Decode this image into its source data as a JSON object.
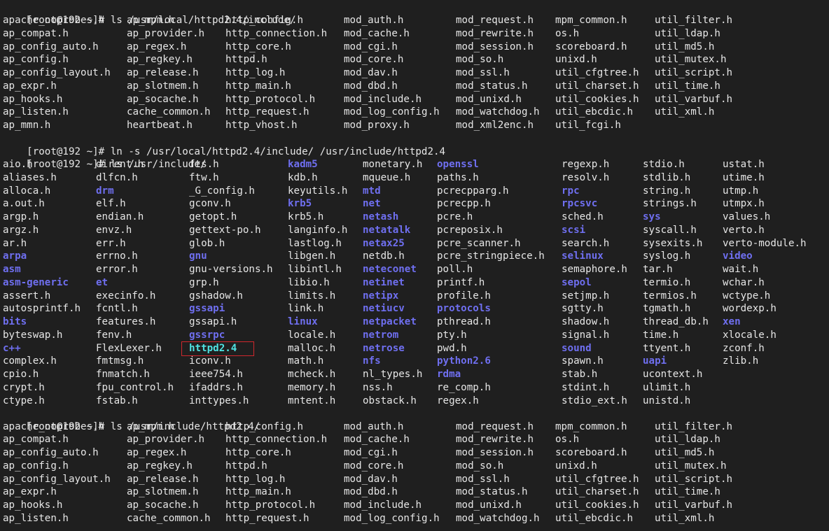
{
  "terminal": {
    "prompt": "[root@192 ~]# ",
    "colors": {
      "background": "#1f1f1f",
      "text": "#e6e6e6",
      "directory": "#6f6ff0",
      "symlink": "#4fe3e3",
      "highlight_box": "#d0282d"
    },
    "commands": [
      "ls /usr/local/httpd2.4/include/",
      "ln -s /usr/local/httpd2.4/include/ /usr/include/httpd2.4",
      "ls /usr/include/",
      "ls /usr/include/httpd2.4/"
    ],
    "listing_httpd_include": {
      "columns": [
        [
          "apache_noprobes.h",
          "ap_compat.h",
          "ap_config_auto.h",
          "ap_config.h",
          "ap_config_layout.h",
          "ap_expr.h",
          "ap_hooks.h",
          "ap_listen.h",
          "ap_mmn.h"
        ],
        [
          "ap_mpm.h",
          "ap_provider.h",
          "ap_regex.h",
          "ap_regkey.h",
          "ap_release.h",
          "ap_slotmem.h",
          "ap_socache.h",
          "cache_common.h",
          "heartbeat.h"
        ],
        [
          "http_config.h",
          "http_connection.h",
          "http_core.h",
          "httpd.h",
          "http_log.h",
          "http_main.h",
          "http_protocol.h",
          "http_request.h",
          "http_vhost.h"
        ],
        [
          "mod_auth.h",
          "mod_cache.h",
          "mod_cgi.h",
          "mod_core.h",
          "mod_dav.h",
          "mod_dbd.h",
          "mod_include.h",
          "mod_log_config.h",
          "mod_proxy.h"
        ],
        [
          "mod_request.h",
          "mod_rewrite.h",
          "mod_session.h",
          "mod_so.h",
          "mod_ssl.h",
          "mod_status.h",
          "mod_unixd.h",
          "mod_watchdog.h",
          "mod_xml2enc.h"
        ],
        [
          "mpm_common.h",
          "os.h",
          "scoreboard.h",
          "unixd.h",
          "util_cfgtree.h",
          "util_charset.h",
          "util_cookies.h",
          "util_ebcdic.h",
          "util_fcgi.h"
        ],
        [
          "util_filter.h",
          "util_ldap.h",
          "util_md5.h",
          "util_mutex.h",
          "util_script.h",
          "util_time.h",
          "util_varbuf.h",
          "util_xml.h",
          ""
        ]
      ]
    },
    "listing_usr_include": {
      "columns": [
        [
          {
            "n": "aio.h"
          },
          {
            "n": "aliases.h"
          },
          {
            "n": "alloca.h"
          },
          {
            "n": "a.out.h"
          },
          {
            "n": "argp.h"
          },
          {
            "n": "argz.h"
          },
          {
            "n": "ar.h"
          },
          {
            "n": "arpa",
            "t": "dir"
          },
          {
            "n": "asm",
            "t": "dir"
          },
          {
            "n": "asm-generic",
            "t": "dir"
          },
          {
            "n": "assert.h"
          },
          {
            "n": "autosprintf.h"
          },
          {
            "n": "bits",
            "t": "dir"
          },
          {
            "n": "byteswap.h"
          },
          {
            "n": "c++",
            "t": "dir"
          },
          {
            "n": "complex.h"
          },
          {
            "n": "cpio.h"
          },
          {
            "n": "crypt.h"
          },
          {
            "n": "ctype.h"
          }
        ],
        [
          {
            "n": "dirent.h"
          },
          {
            "n": "dlfcn.h"
          },
          {
            "n": "drm",
            "t": "dir"
          },
          {
            "n": "elf.h"
          },
          {
            "n": "endian.h"
          },
          {
            "n": "envz.h"
          },
          {
            "n": "err.h"
          },
          {
            "n": "errno.h"
          },
          {
            "n": "error.h"
          },
          {
            "n": "et",
            "t": "dir"
          },
          {
            "n": "execinfo.h"
          },
          {
            "n": "fcntl.h"
          },
          {
            "n": "features.h"
          },
          {
            "n": "fenv.h"
          },
          {
            "n": "FlexLexer.h"
          },
          {
            "n": "fmtmsg.h"
          },
          {
            "n": "fnmatch.h"
          },
          {
            "n": "fpu_control.h"
          },
          {
            "n": "fstab.h"
          }
        ],
        [
          {
            "n": "fts.h"
          },
          {
            "n": "ftw.h"
          },
          {
            "n": "_G_config.h"
          },
          {
            "n": "gconv.h"
          },
          {
            "n": "getopt.h"
          },
          {
            "n": "gettext-po.h"
          },
          {
            "n": "glob.h"
          },
          {
            "n": "gnu",
            "t": "dir"
          },
          {
            "n": "gnu-versions.h"
          },
          {
            "n": "grp.h"
          },
          {
            "n": "gshadow.h"
          },
          {
            "n": "gssapi",
            "t": "dir"
          },
          {
            "n": "gssapi.h"
          },
          {
            "n": "gssrpc",
            "t": "dir"
          },
          {
            "n": "httpd2.4",
            "t": "link",
            "highlighted": true
          },
          {
            "n": "iconv.h"
          },
          {
            "n": "ieee754.h"
          },
          {
            "n": "ifaddrs.h"
          },
          {
            "n": "inttypes.h"
          }
        ],
        [
          {
            "n": "kadm5",
            "t": "dir"
          },
          {
            "n": "kdb.h"
          },
          {
            "n": "keyutils.h"
          },
          {
            "n": "krb5",
            "t": "dir"
          },
          {
            "n": "krb5.h"
          },
          {
            "n": "langinfo.h"
          },
          {
            "n": "lastlog.h"
          },
          {
            "n": "libgen.h"
          },
          {
            "n": "libintl.h"
          },
          {
            "n": "libio.h"
          },
          {
            "n": "limits.h"
          },
          {
            "n": "link.h"
          },
          {
            "n": "linux",
            "t": "dir"
          },
          {
            "n": "locale.h"
          },
          {
            "n": "malloc.h"
          },
          {
            "n": "math.h"
          },
          {
            "n": "mcheck.h"
          },
          {
            "n": "memory.h"
          },
          {
            "n": "mntent.h"
          }
        ],
        [
          {
            "n": "monetary.h"
          },
          {
            "n": "mqueue.h"
          },
          {
            "n": "mtd",
            "t": "dir"
          },
          {
            "n": "net",
            "t": "dir"
          },
          {
            "n": "netash",
            "t": "dir"
          },
          {
            "n": "netatalk",
            "t": "dir"
          },
          {
            "n": "netax25",
            "t": "dir"
          },
          {
            "n": "netdb.h"
          },
          {
            "n": "neteconet",
            "t": "dir"
          },
          {
            "n": "netinet",
            "t": "dir"
          },
          {
            "n": "netipx",
            "t": "dir"
          },
          {
            "n": "netiucv",
            "t": "dir"
          },
          {
            "n": "netpacket",
            "t": "dir"
          },
          {
            "n": "netrom",
            "t": "dir"
          },
          {
            "n": "netrose",
            "t": "dir"
          },
          {
            "n": "nfs",
            "t": "dir"
          },
          {
            "n": "nl_types.h"
          },
          {
            "n": "nss.h"
          },
          {
            "n": "obstack.h"
          }
        ],
        [
          {
            "n": "openssl",
            "t": "dir"
          },
          {
            "n": "paths.h"
          },
          {
            "n": "pcrecpparg.h"
          },
          {
            "n": "pcrecpp.h"
          },
          {
            "n": "pcre.h"
          },
          {
            "n": "pcreposix.h"
          },
          {
            "n": "pcre_scanner.h"
          },
          {
            "n": "pcre_stringpiece.h"
          },
          {
            "n": "poll.h"
          },
          {
            "n": "printf.h"
          },
          {
            "n": "profile.h"
          },
          {
            "n": "protocols",
            "t": "dir"
          },
          {
            "n": "pthread.h"
          },
          {
            "n": "pty.h"
          },
          {
            "n": "pwd.h"
          },
          {
            "n": "python2.6",
            "t": "dir"
          },
          {
            "n": "rdma",
            "t": "dir"
          },
          {
            "n": "re_comp.h"
          },
          {
            "n": "regex.h"
          }
        ],
        [
          {
            "n": "regexp.h"
          },
          {
            "n": "resolv.h"
          },
          {
            "n": "rpc",
            "t": "dir"
          },
          {
            "n": "rpcsvc",
            "t": "dir"
          },
          {
            "n": "sched.h"
          },
          {
            "n": "scsi",
            "t": "dir"
          },
          {
            "n": "search.h"
          },
          {
            "n": "selinux",
            "t": "dir"
          },
          {
            "n": "semaphore.h"
          },
          {
            "n": "sepol",
            "t": "dir"
          },
          {
            "n": "setjmp.h"
          },
          {
            "n": "sgtty.h"
          },
          {
            "n": "shadow.h"
          },
          {
            "n": "signal.h"
          },
          {
            "n": "sound",
            "t": "dir"
          },
          {
            "n": "spawn.h"
          },
          {
            "n": "stab.h"
          },
          {
            "n": "stdint.h"
          },
          {
            "n": "stdio_ext.h"
          }
        ],
        [
          {
            "n": "stdio.h"
          },
          {
            "n": "stdlib.h"
          },
          {
            "n": "string.h"
          },
          {
            "n": "strings.h"
          },
          {
            "n": "sys",
            "t": "dir"
          },
          {
            "n": "syscall.h"
          },
          {
            "n": "sysexits.h"
          },
          {
            "n": "syslog.h"
          },
          {
            "n": "tar.h"
          },
          {
            "n": "termio.h"
          },
          {
            "n": "termios.h"
          },
          {
            "n": "tgmath.h"
          },
          {
            "n": "thread_db.h"
          },
          {
            "n": "time.h"
          },
          {
            "n": "ttyent.h"
          },
          {
            "n": "uapi",
            "t": "dir"
          },
          {
            "n": "ucontext.h"
          },
          {
            "n": "ulimit.h"
          },
          {
            "n": "unistd.h"
          }
        ],
        [
          {
            "n": "ustat.h"
          },
          {
            "n": "utime.h"
          },
          {
            "n": "utmp.h"
          },
          {
            "n": "utmpx.h"
          },
          {
            "n": "values.h"
          },
          {
            "n": "verto.h"
          },
          {
            "n": "verto-module.h"
          },
          {
            "n": "video",
            "t": "dir"
          },
          {
            "n": "wait.h"
          },
          {
            "n": "wchar.h"
          },
          {
            "n": "wctype.h"
          },
          {
            "n": "wordexp.h"
          },
          {
            "n": "xen",
            "t": "dir"
          },
          {
            "n": "xlocale.h"
          },
          {
            "n": "zconf.h"
          },
          {
            "n": "zlib.h"
          }
        ]
      ]
    },
    "listing_usr_include_httpd": {
      "columns": [
        [
          "apache_noprobes.h",
          "ap_compat.h",
          "ap_config_auto.h",
          "ap_config.h",
          "ap_config_layout.h",
          "ap_expr.h",
          "ap_hooks.h",
          "ap_listen.h"
        ],
        [
          "ap_mpm.h",
          "ap_provider.h",
          "ap_regex.h",
          "ap_regkey.h",
          "ap_release.h",
          "ap_slotmem.h",
          "ap_socache.h",
          "cache_common.h"
        ],
        [
          "http_config.h",
          "http_connection.h",
          "http_core.h",
          "httpd.h",
          "http_log.h",
          "http_main.h",
          "http_protocol.h",
          "http_request.h"
        ],
        [
          "mod_auth.h",
          "mod_cache.h",
          "mod_cgi.h",
          "mod_core.h",
          "mod_dav.h",
          "mod_dbd.h",
          "mod_include.h",
          "mod_log_config.h"
        ],
        [
          "mod_request.h",
          "mod_rewrite.h",
          "mod_session.h",
          "mod_so.h",
          "mod_ssl.h",
          "mod_status.h",
          "mod_unixd.h",
          "mod_watchdog.h"
        ],
        [
          "mpm_common.h",
          "os.h",
          "scoreboard.h",
          "unixd.h",
          "util_cfgtree.h",
          "util_charset.h",
          "util_cookies.h",
          "util_ebcdic.h"
        ],
        [
          "util_filter.h",
          "util_ldap.h",
          "util_md5.h",
          "util_mutex.h",
          "util_script.h",
          "util_time.h",
          "util_varbuf.h",
          "util_xml.h"
        ]
      ]
    }
  }
}
